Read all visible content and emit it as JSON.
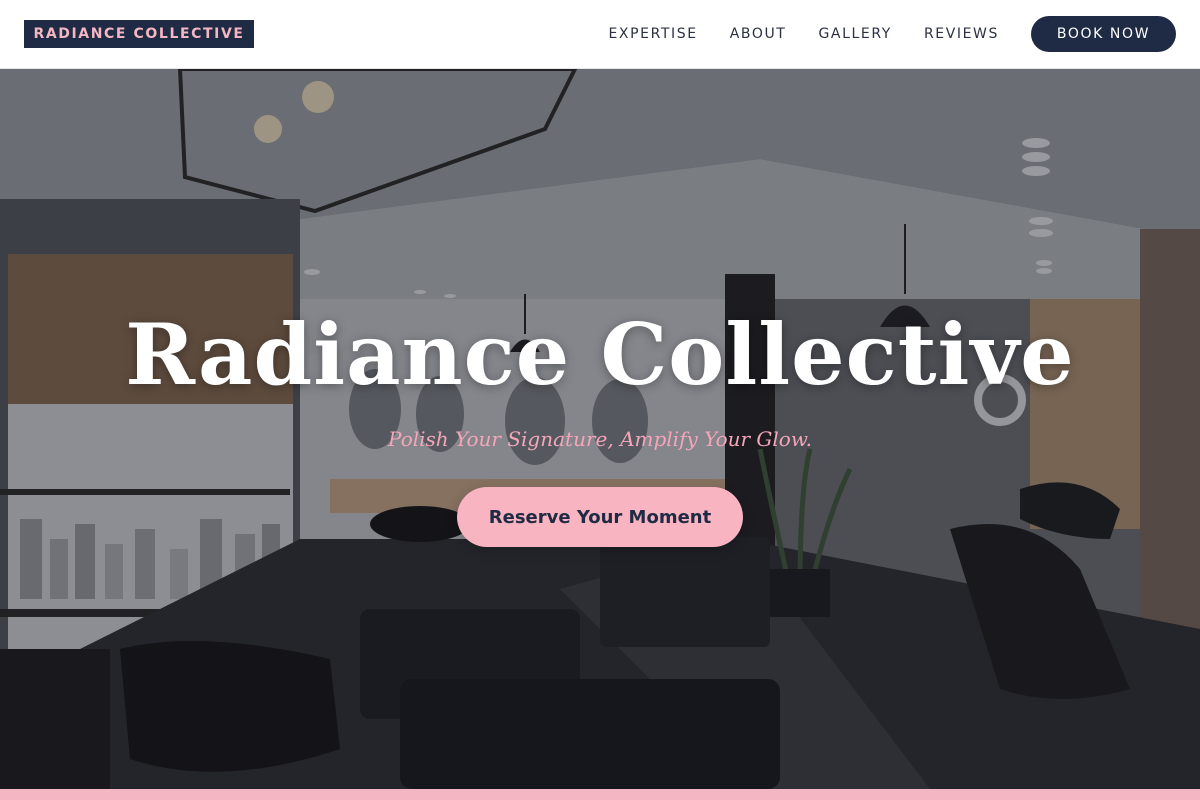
{
  "header": {
    "brand": "RADIANCE COLLECTIVE",
    "nav": [
      {
        "label": "EXPERTISE"
      },
      {
        "label": "ABOUT"
      },
      {
        "label": "GALLERY"
      },
      {
        "label": "REVIEWS"
      }
    ],
    "book_button": "BOOK NOW"
  },
  "hero": {
    "title": "Radiance Collective",
    "tagline": "Polish Your Signature, Amplify Your Glow.",
    "cta": "Reserve Your Moment",
    "background_image": "salon interior photo"
  },
  "colors": {
    "navy": "#1f2a44",
    "pink": "#f8b5c1",
    "tagline_pink": "#f4a6b8",
    "white": "#ffffff"
  }
}
